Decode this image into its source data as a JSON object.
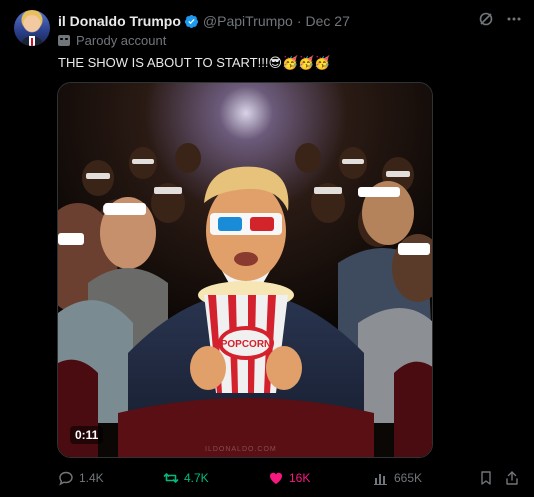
{
  "author": {
    "display_name": "il Donaldo Trumpo",
    "handle": "@PapiTrumpo",
    "date": "Dec 27",
    "label": "Parody account",
    "verified": true
  },
  "post": {
    "text": "THE SHOW IS ABOUT TO START!!!😎🥳🥳🥳"
  },
  "media": {
    "duration": "0:11",
    "watermark": "ILDONALDO.COM"
  },
  "actions": {
    "replies": "1.4K",
    "reposts": "4.7K",
    "likes": "16K",
    "views": "665K"
  },
  "colors": {
    "background": "#000000",
    "text_primary": "#e7e9ea",
    "text_secondary": "#71767b",
    "verified": "#1d9bf0",
    "repost": "#00ba7c",
    "like": "#f91880"
  },
  "icons": {
    "verified": "verified-badge-icon",
    "grok": "grok-icon",
    "more": "more-options-icon",
    "parody": "parody-mask-icon",
    "reply": "reply-icon",
    "repost": "repost-icon",
    "like": "heart-icon",
    "views": "views-chart-icon",
    "bookmark": "bookmark-icon",
    "share": "share-icon"
  }
}
